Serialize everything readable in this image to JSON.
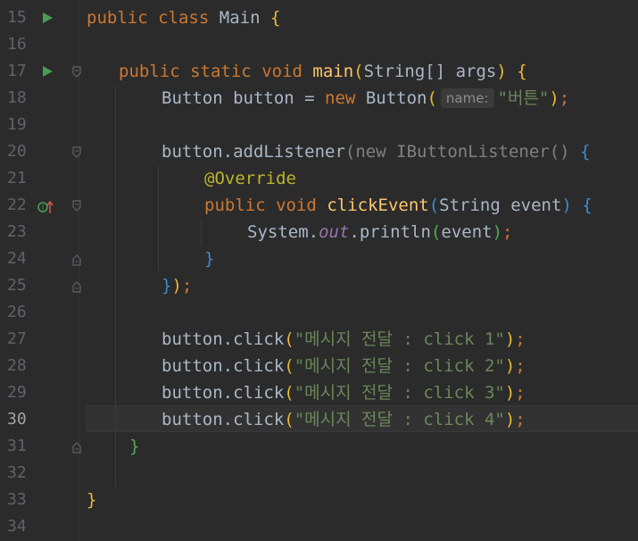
{
  "editor": {
    "current_line": "30",
    "lines": [
      {
        "num": "15"
      },
      {
        "num": "16"
      },
      {
        "num": "17"
      },
      {
        "num": "18"
      },
      {
        "num": "19"
      },
      {
        "num": "20"
      },
      {
        "num": "21"
      },
      {
        "num": "22"
      },
      {
        "num": "23"
      },
      {
        "num": "24"
      },
      {
        "num": "25"
      },
      {
        "num": "26"
      },
      {
        "num": "27"
      },
      {
        "num": "28"
      },
      {
        "num": "29"
      },
      {
        "num": "30"
      },
      {
        "num": "31"
      },
      {
        "num": "32"
      },
      {
        "num": "33"
      },
      {
        "num": "34"
      }
    ],
    "code": {
      "l15": {
        "kw1": "public",
        "kw2": "class",
        "name": "Main",
        "brace": "{"
      },
      "l17": {
        "kw1": "public",
        "kw2": "static",
        "kw3": "void",
        "fn": "main",
        "paren_open": "(",
        "params": "String[] args",
        "paren_close": ")",
        "brace": "{"
      },
      "l18": {
        "pre": "Button button = ",
        "kw": "new",
        "ctor": "Button",
        "paren_open": "(",
        "hint": "name:",
        "str": "\"버튼\"",
        "paren_close": ")",
        "end": ";"
      },
      "l20": {
        "pre": "button.addListener",
        "paren_open": "(",
        "kw": "new",
        "iface": "IButtonListener()",
        "sp": " ",
        "brace": "{"
      },
      "l21": {
        "ann": "@Override"
      },
      "l22": {
        "kw1": "public",
        "kw2": "void",
        "fn": "clickEvent",
        "paren_open": "(",
        "params": "String event",
        "paren_close": ")",
        "brace": "{"
      },
      "l23": {
        "pre": "System.",
        "field": "out",
        "mid": ".println",
        "paren_open": "(",
        "arg": "event",
        "paren_close": ")",
        "end": ";"
      },
      "l24": {
        "brace": "}"
      },
      "l25": {
        "brace": "}",
        "paren": ")",
        "end": ";"
      },
      "l27": {
        "pre": "button.click",
        "paren_open": "(",
        "str": "\"메시지 전달 : click 1\"",
        "paren_close": ")",
        "end": ";"
      },
      "l28": {
        "pre": "button.click",
        "paren_open": "(",
        "str": "\"메시지 전달 : click 2\"",
        "paren_close": ")",
        "end": ";"
      },
      "l29": {
        "pre": "button.click",
        "paren_open": "(",
        "str": "\"메시지 전달 : click 3\"",
        "paren_close": ")",
        "end": ";"
      },
      "l30": {
        "pre": "button.click",
        "paren_open": "(",
        "str": "\"메시지 전달 : click 4\"",
        "paren_close": ")",
        "end": ";"
      },
      "l31": {
        "brace": "}"
      },
      "l33": {
        "brace": "}"
      }
    },
    "icons": {
      "run": "run-icon",
      "override": "override-method-icon",
      "fold": "fold-marker-icon"
    },
    "colors": {
      "background": "#2b2b2b",
      "keyword": "#cc7832",
      "function": "#ffc66d",
      "string": "#6a8759",
      "annotation": "#bbb529",
      "run_icon": "#499c54"
    }
  }
}
